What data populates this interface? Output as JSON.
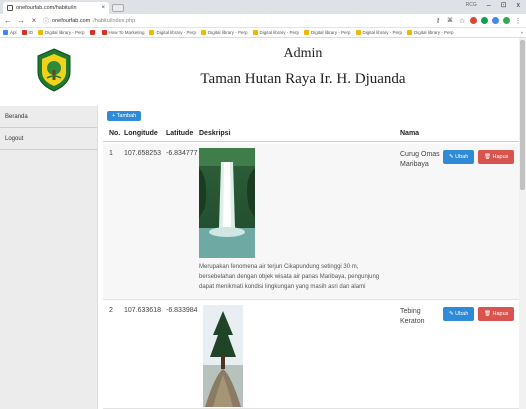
{
  "browser": {
    "tab_title": "onefourfab.com/habitu/in",
    "tab_close": "×",
    "window_user": "RCG",
    "window_min": "–",
    "window_max": "⊡",
    "window_close": "x",
    "url_host": "onefourfab.com",
    "url_path": "/habitu/index.php",
    "bookmarks": [
      {
        "label": "Apl",
        "color": "#4285f4"
      },
      {
        "label": "ID",
        "color": "#d93025"
      },
      {
        "label": "Digital library - Perp",
        "color": "#f2b705"
      },
      {
        "label": "",
        "color": "#d93025"
      },
      {
        "label": "How To Marketing",
        "color": "#d93025"
      },
      {
        "label": "Digital library - Perp",
        "color": "#f2b705"
      },
      {
        "label": "Digital library - Perp",
        "color": "#f2b705"
      },
      {
        "label": "Digital library - Perp",
        "color": "#f2b705"
      },
      {
        "label": "Digital library - Perp",
        "color": "#f2b705"
      },
      {
        "label": "Digital library - Perp",
        "color": "#f2b705"
      },
      {
        "label": "Digital library - Perp",
        "color": "#f2b705"
      }
    ],
    "bookmarks_more": "»"
  },
  "header": {
    "title": "Admin",
    "subtitle": "Taman Hutan Raya Ir. H. Djuanda"
  },
  "sidebar": {
    "items": [
      {
        "label": "Beranda"
      },
      {
        "label": "Logout"
      }
    ]
  },
  "toolbar": {
    "add_label": "+ Tambah"
  },
  "table": {
    "headers": [
      "No.",
      "Longitude",
      "Latitude",
      "Deskripsi",
      "Nama"
    ],
    "rows": [
      {
        "no": "1",
        "longitude": "107.658253",
        "latitude": "-6.834777",
        "deskripsi": "Merupakan fenomena air terjun Cikapundung setinggi 30 m, bersebelahan dengan objek wisata air panas Maribaya, pengunjung dapat menikmati kondisi lingkungan yang masih asri dan alami",
        "nama": "Curug Omas Maribaya",
        "edit_label": "✎ Ubah",
        "delete_label": "🗑 Hapus"
      },
      {
        "no": "2",
        "longitude": "107.633618",
        "latitude": "-6.833984",
        "deskripsi": "",
        "nama": "Tebing Keraton",
        "edit_label": "✎ Ubah",
        "delete_label": "🗑 Hapus"
      }
    ]
  },
  "colors": {
    "primary": "#2f8ad8",
    "danger": "#d9534f",
    "sidebar_bg": "#ececec"
  }
}
